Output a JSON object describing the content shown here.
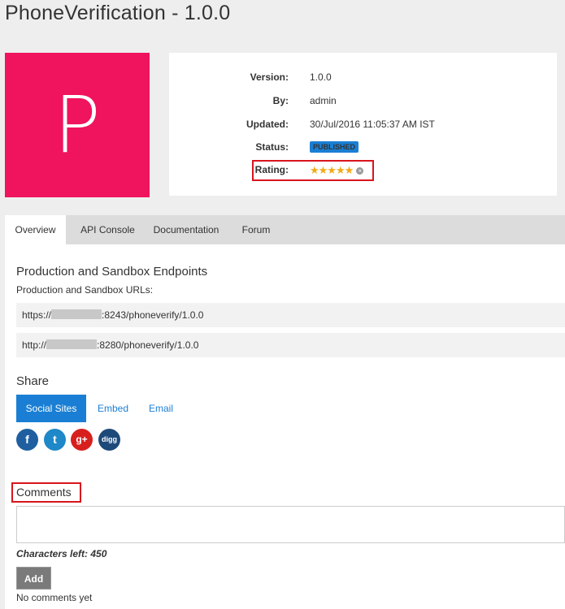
{
  "page": {
    "title": "PhoneVerification - 1.0.0",
    "logo_letter": "P"
  },
  "info": {
    "version_label": "Version:",
    "version": "1.0.0",
    "by_label": "By:",
    "by": "admin",
    "updated_label": "Updated:",
    "updated": "30/Jul/2016 11:05:37 AM IST",
    "status_label": "Status:",
    "status": "PUBLISHED",
    "rating_label": "Rating:",
    "rating_stars": "★★★★★",
    "clear_icon": "×"
  },
  "tabs": [
    {
      "label": "Overview"
    },
    {
      "label": "API Console"
    },
    {
      "label": "Documentation"
    },
    {
      "label": "Forum"
    }
  ],
  "endpoints": {
    "heading": "Production and Sandbox Endpoints",
    "subheading": "Production and Sandbox URLs:",
    "https_prefix": "https://",
    "https_suffix": ":8243/phoneverify/1.0.0",
    "http_prefix": "http://",
    "http_suffix": ":8280/phoneverify/1.0.0"
  },
  "share": {
    "heading": "Share",
    "tabs": [
      "Social Sites",
      "Embed",
      "Email"
    ],
    "icons": [
      "f",
      "t",
      "g+",
      "digg"
    ]
  },
  "comments": {
    "heading": "Comments",
    "chars_left": "Characters left: 450",
    "add_label": "Add",
    "none_text": "No comments yet"
  },
  "colors": {
    "logo_bg": "#f0135d",
    "accent": "#1a7fd4",
    "highlight": "#d9151d",
    "star": "#f4a916"
  }
}
